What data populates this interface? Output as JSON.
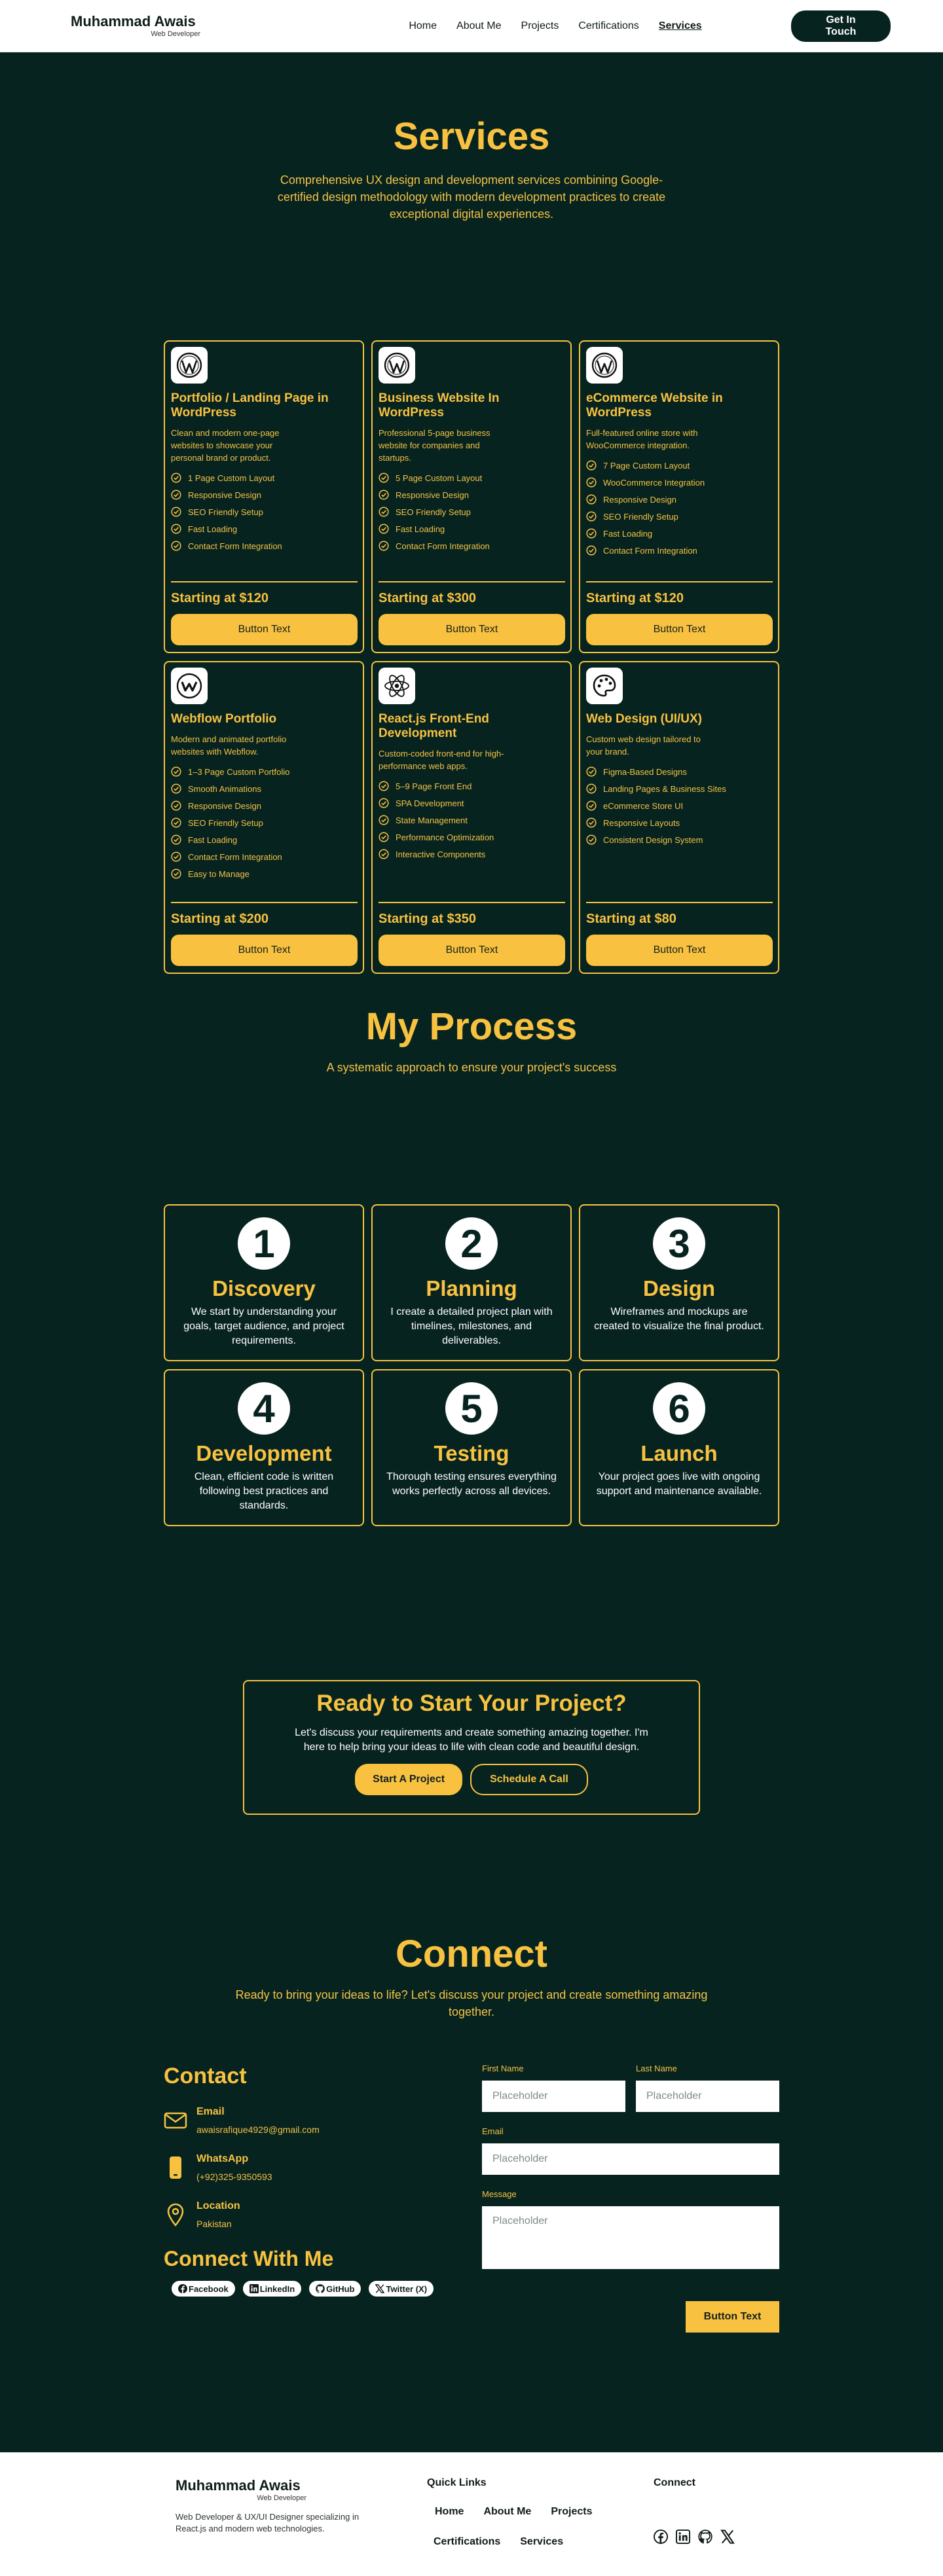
{
  "nav": {
    "brand_name": "Muhammad Awais",
    "brand_sub": "Web Developer",
    "links": [
      "Home",
      "About Me",
      "Projects",
      "Certifications",
      "Services"
    ],
    "cta": "Get In Touch"
  },
  "services": {
    "title": "Services",
    "subtitle": "Comprehensive UX design and development services combining Google-certified design methodology with modern development practices to create exceptional digital experiences.",
    "cards": [
      {
        "icon": "wordpress-icon",
        "title": "Portfolio / Landing Page in WordPress",
        "desc": "Clean and modern one-page websites to showcase your personal brand or product.",
        "features": [
          "1 Page Custom Layout",
          "Responsive Design",
          "SEO Friendly Setup",
          "Fast Loading",
          "Contact Form Integration"
        ],
        "price": "Starting at $120",
        "button": "Button Text"
      },
      {
        "icon": "wordpress-icon",
        "title": "Business Website In WordPress",
        "desc": "Professional 5-page business website for companies and startups.",
        "features": [
          "5 Page Custom Layout",
          "Responsive Design",
          "SEO Friendly Setup",
          "Fast Loading",
          "Contact Form Integration"
        ],
        "price": "Starting at $300",
        "button": "Button Text"
      },
      {
        "icon": "wordpress-icon",
        "title": "eCommerce Website in WordPress",
        "desc": "Full-featured online store with WooCommerce integration.",
        "features": [
          "7 Page Custom Layout",
          "WooCommerce Integration",
          "Responsive Design",
          "SEO Friendly Setup",
          "Fast Loading",
          "Contact Form Integration"
        ],
        "price": "Starting at $120",
        "button": "Button Text"
      },
      {
        "icon": "webflow-icon",
        "title": "Webflow Portfolio",
        "desc": "Modern and animated portfolio websites with Webflow.",
        "features": [
          "1–3 Page Custom Portfolio",
          "Smooth Animations",
          "Responsive Design",
          "SEO Friendly Setup",
          "Fast Loading",
          "Contact Form Integration",
          "Easy to Manage"
        ],
        "price": "Starting at $200",
        "button": "Button Text"
      },
      {
        "icon": "react-icon",
        "title": "React.js Front-End Development",
        "desc": "Custom-coded front-end for high-performance web apps.",
        "features": [
          "5–9 Page Front End",
          "SPA Development",
          "State Management",
          "Performance Optimization",
          "Interactive Components"
        ],
        "price": "Starting at $350",
        "button": "Button Text"
      },
      {
        "icon": "palette-icon",
        "title": "Web Design (UI/UX)",
        "desc": "Custom web design tailored to your brand.",
        "features": [
          "Figma-Based Designs",
          "Landing Pages & Business Sites",
          "eCommerce Store UI",
          "Responsive Layouts",
          "Consistent Design System"
        ],
        "price": "Starting at $80",
        "button": "Button Text"
      }
    ]
  },
  "process": {
    "title": "My Process",
    "subtitle": "A systematic approach to ensure your project's success",
    "steps": [
      {
        "num": "1",
        "title": "Discovery",
        "desc": "We start by understanding your goals, target audience, and project requirements."
      },
      {
        "num": "2",
        "title": "Planning",
        "desc": "I create a detailed project plan with timelines, milestones, and deliverables."
      },
      {
        "num": "3",
        "title": "Design",
        "desc": "Wireframes and mockups are created to visualize the final product."
      },
      {
        "num": "4",
        "title": "Development",
        "desc": "Clean, efficient code is written following best practices and standards."
      },
      {
        "num": "5",
        "title": "Testing",
        "desc": "Thorough testing ensures everything works perfectly across all devices."
      },
      {
        "num": "6",
        "title": "Launch",
        "desc": "Your project goes live with ongoing support and maintenance available."
      }
    ]
  },
  "cta": {
    "title": "Ready to Start Your Project?",
    "text": "Let's discuss your requirements and create something amazing together. I'm here to help bring your ideas to life with clean code and beautiful design.",
    "primary": "Start A Project",
    "secondary": "Schedule A Call"
  },
  "connect": {
    "title": "Connect",
    "subtitle": "Ready to bring your ideas to life? Let's discuss your project and create something amazing together.",
    "contact_heading": "Contact",
    "email_label": "Email",
    "email_value": "awaisrafique4929@gmail.com",
    "whatsapp_label": "WhatsApp",
    "whatsapp_value": "(+92)325-9350593",
    "location_label": "Location",
    "location_value": "Pakistan",
    "connect_heading": "Connect With Me",
    "socials": [
      "Facebook",
      "LinkedIn",
      "GitHub",
      "Twitter (X)"
    ],
    "form": {
      "first_name_label": "First Name",
      "last_name_label": "Last Name",
      "email_label": "Email",
      "message_label": "Message",
      "placeholder": "Placeholder",
      "submit": "Button Text"
    }
  },
  "footer": {
    "brand_name": "Muhammad Awais",
    "brand_sub": "Web Developer",
    "desc": "Web Developer & UX/UI Designer specializing in React.js and modern web technologies.",
    "quick_links_heading": "Quick Links",
    "links_row1": [
      "Home",
      "About Me",
      "Projects"
    ],
    "links_row2": [
      "Certifications",
      "Services"
    ],
    "connect_heading": "Connect",
    "social_icons": [
      "facebook-icon",
      "linkedin-icon",
      "github-icon",
      "x-icon"
    ]
  },
  "colors": {
    "dark": "#072320",
    "gold": "#f8c240"
  }
}
